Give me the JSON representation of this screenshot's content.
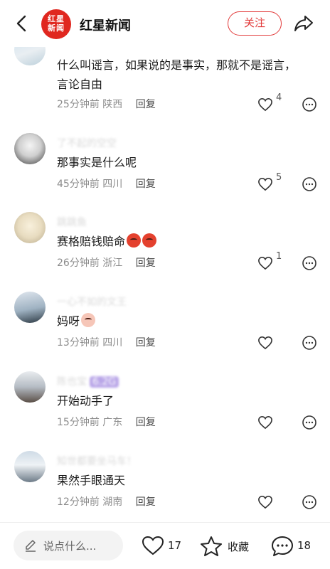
{
  "header": {
    "logo_line1": "红星",
    "logo_line2": "新闻",
    "brand_name": "红星新闻",
    "follow_label": "关注"
  },
  "comments": [
    {
      "nickname": "",
      "text": "什么叫谣言，如果说的是事实，那就不是谣言，言论自由",
      "time": "25分钟前",
      "location": "陕西",
      "reply_label": "回复",
      "likes": "4"
    },
    {
      "nickname": "了不起的空空",
      "text": "那事实是什么呢",
      "time": "45分钟前",
      "location": "四川",
      "reply_label": "回复",
      "likes": "5"
    },
    {
      "nickname": "跳跳鱼",
      "text": "赛格赔钱赔命",
      "time": "26分钟前",
      "location": "浙江",
      "reply_label": "回复",
      "likes": "1"
    },
    {
      "nickname": "一心不如的文王",
      "text": "妈呀",
      "time": "13分钟前",
      "location": "四川",
      "reply_label": "回复",
      "likes": ""
    },
    {
      "nickname": "陈也宝",
      "nickname_badge": "6.2G",
      "text": "开始动手了",
      "time": "15分钟前",
      "location": "广东",
      "reply_label": "回复",
      "likes": ""
    },
    {
      "nickname": "知世都要坐马车！",
      "text": "果然手眼通天",
      "time": "12分钟前",
      "location": "湖南",
      "reply_label": "回复",
      "likes": ""
    }
  ],
  "bottom": {
    "input_placeholder": "说点什么...",
    "like_count": "17",
    "collect_label": "收藏",
    "comment_count": "18"
  },
  "colors": {
    "brand_red": "#e0271f",
    "follow_red": "#e23b3b",
    "meta_gray": "#8c8c8c"
  }
}
